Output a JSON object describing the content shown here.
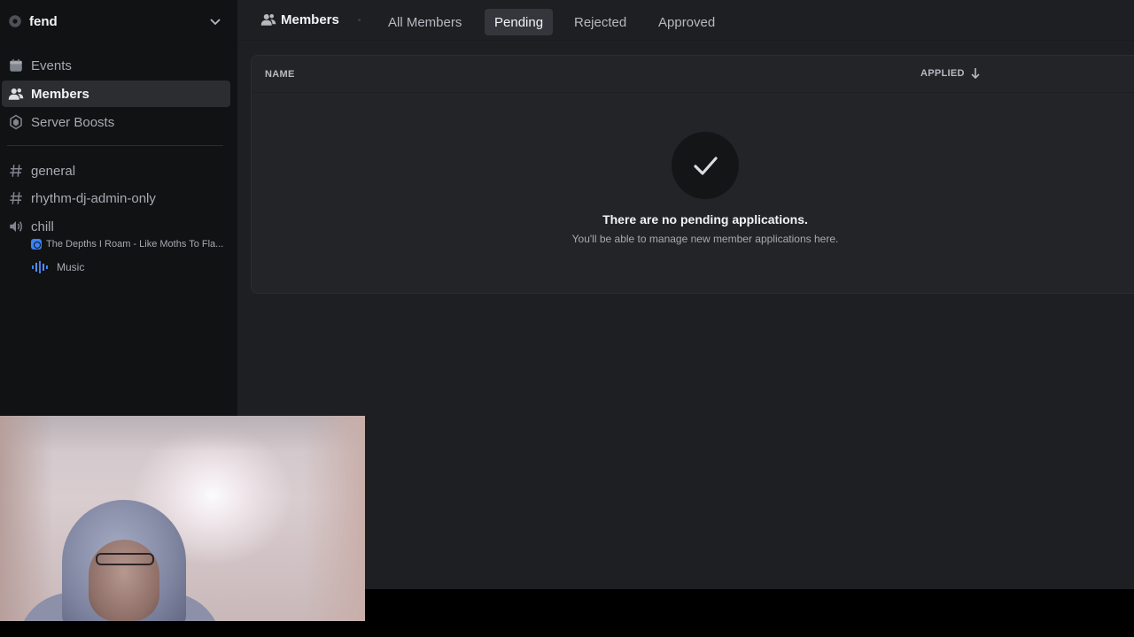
{
  "server": {
    "name": "fend"
  },
  "sidebar": {
    "nav": [
      {
        "label": "Events",
        "icon": "calendar-icon"
      },
      {
        "label": "Members",
        "icon": "members-icon",
        "active": true
      },
      {
        "label": "Server Boosts",
        "icon": "boost-icon"
      }
    ],
    "channels": [
      {
        "label": "general",
        "icon": "hashtag-icon"
      },
      {
        "label": "rhythm-dj-admin-only",
        "icon": "hashtag-icon"
      },
      {
        "label": "chill",
        "icon": "speaker-icon"
      }
    ],
    "voice_activity": "The Depths I Roam - Like Moths To Fla...",
    "voice_user": "Music"
  },
  "header": {
    "title": "Members",
    "tabs": [
      "All Members",
      "Pending",
      "Rejected",
      "Approved"
    ],
    "active_tab": "Pending"
  },
  "table": {
    "col_name": "NAME",
    "col_applied": "APPLIED"
  },
  "empty_state": {
    "title": "There are no pending applications.",
    "subtitle": "You'll be able to manage new member applications here."
  },
  "colors": {
    "background": "#1e1f22",
    "sidebar": "#111214",
    "panel": "#232428",
    "active_tab": "#34363c",
    "accent_blue": "#3b82f6"
  }
}
